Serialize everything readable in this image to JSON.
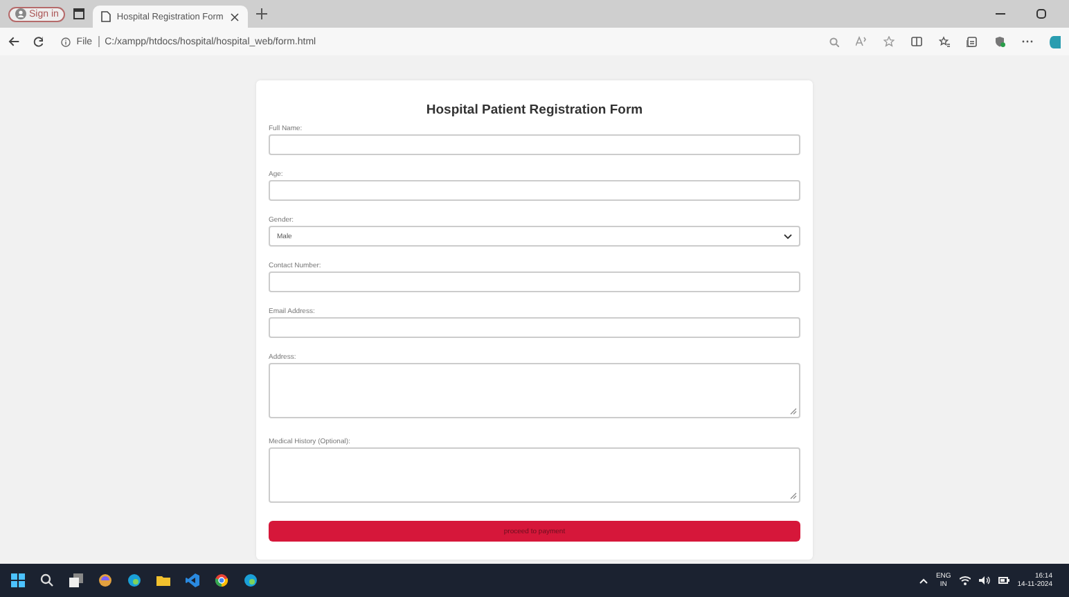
{
  "browser": {
    "profile": "Sign in",
    "tabs": [
      {
        "title": "Hospital Registration Form",
        "selected": true
      }
    ],
    "address": {
      "scheme": "File",
      "url": "C:/xampp/htdocs/hospital/hospital_web/form.html"
    }
  },
  "form": {
    "title": "Hospital Patient Registration Form",
    "fields": [
      {
        "kind": "text",
        "label": "Full Name:"
      },
      {
        "kind": "text",
        "label": "Age:"
      },
      {
        "kind": "select",
        "label": "Gender:",
        "value": "Male"
      },
      {
        "kind": "text",
        "label": "Contact Number:"
      },
      {
        "kind": "text",
        "label": "Email Address:"
      },
      {
        "kind": "textarea",
        "label": "Address:"
      },
      {
        "kind": "textarea",
        "label": "Medical History (Optional):"
      }
    ],
    "submit": "proceed to payment"
  },
  "taskbar": {
    "language": "ENG",
    "region": "IN",
    "time": "16:14",
    "date": "14-11-2024"
  }
}
